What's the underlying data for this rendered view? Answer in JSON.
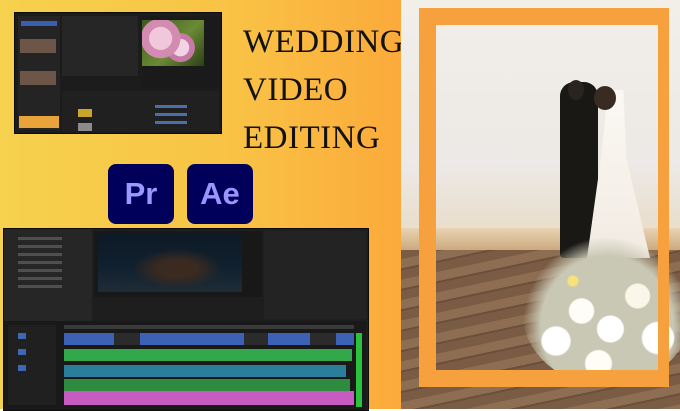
{
  "title": {
    "lines": [
      "WEDDING",
      "VIDEO",
      "EDITING"
    ]
  },
  "apps": {
    "premiere": "Pr",
    "after_effects": "Ae"
  },
  "colors": {
    "background_gradient_start": "#f6d24e",
    "background_gradient_end": "#f7a13a",
    "frame_orange": "#f6a13d",
    "app_icon_bg": "#00005b",
    "app_icon_text": "#9999ff"
  },
  "images": {
    "editor_screenshot_top": "premiere-pro-interface-flower",
    "editor_screenshot_bottom": "premiere-pro-interface-timeline",
    "wedding_photo": "couple-embracing-on-boardwalk-with-bouquet"
  }
}
